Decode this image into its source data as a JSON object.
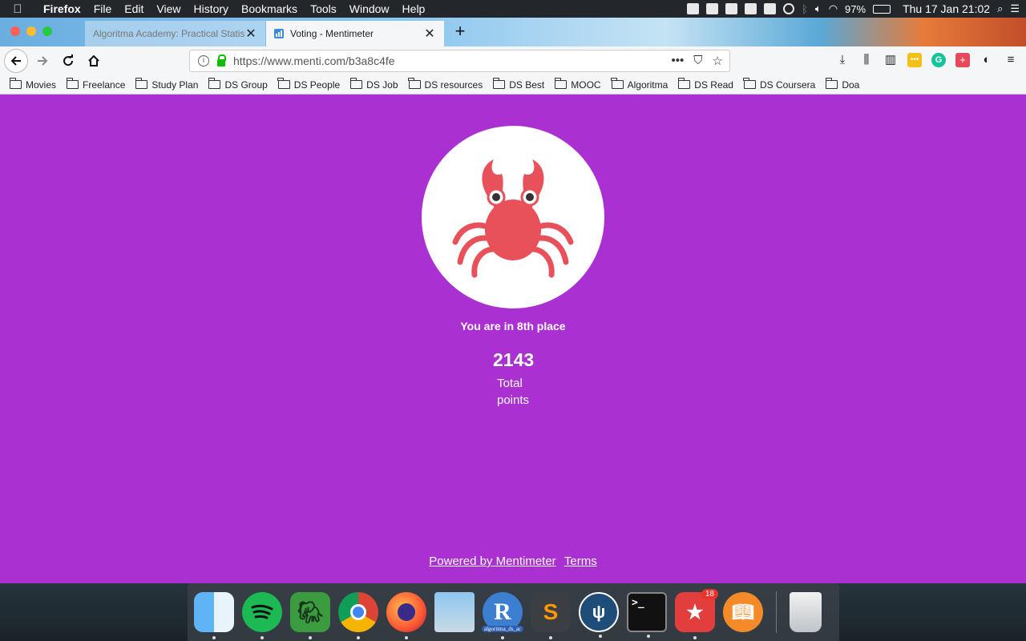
{
  "menubar": {
    "apple": "",
    "app_name": "Firefox",
    "menus": [
      "File",
      "Edit",
      "View",
      "History",
      "Bookmarks",
      "Tools",
      "Window",
      "Help"
    ],
    "battery": "97%",
    "clock": "Thu 17 Jan  21:02"
  },
  "browser": {
    "tabs": [
      {
        "label": "Algoritma Academy: Practical Statis",
        "active": false,
        "close": "✕"
      },
      {
        "label": "Voting - Mentimeter",
        "active": true,
        "close": "✕"
      }
    ],
    "new_tab": "+",
    "url": "https://www.menti.com/b3a8c4fe",
    "url_actions": {
      "more": "•••",
      "pocket": "⛉",
      "bookmark": "☆"
    },
    "bookmarks": [
      "Movies",
      "Freelance",
      "Study Plan",
      "DS Group",
      "DS People",
      "DS Job",
      "DS resources",
      "DS Best",
      "MOOC",
      "Algoritma",
      "DS Read",
      "DS Coursera",
      "Doa"
    ]
  },
  "page": {
    "background": "#ab30d1",
    "avatar_icon": "crab-icon",
    "place_text": "You are in 8th place",
    "points_value": "2143",
    "points_label_line1": "Total",
    "points_label_line2": "points",
    "footer": {
      "powered_by": "Powered by Mentimeter",
      "terms": "Terms"
    }
  },
  "dock": {
    "apps": [
      {
        "name": "finder"
      },
      {
        "name": "spotify"
      },
      {
        "name": "evernote"
      },
      {
        "name": "chrome"
      },
      {
        "name": "firefox"
      },
      {
        "name": "preview"
      },
      {
        "name": "rstudio",
        "sublabel": "algoritma_ds_ac"
      },
      {
        "name": "sublime-text"
      },
      {
        "name": "sourcetree"
      },
      {
        "name": "terminal"
      },
      {
        "name": "wunderlist",
        "badge": "18"
      },
      {
        "name": "ibooks"
      },
      {
        "name": "trash"
      }
    ]
  }
}
